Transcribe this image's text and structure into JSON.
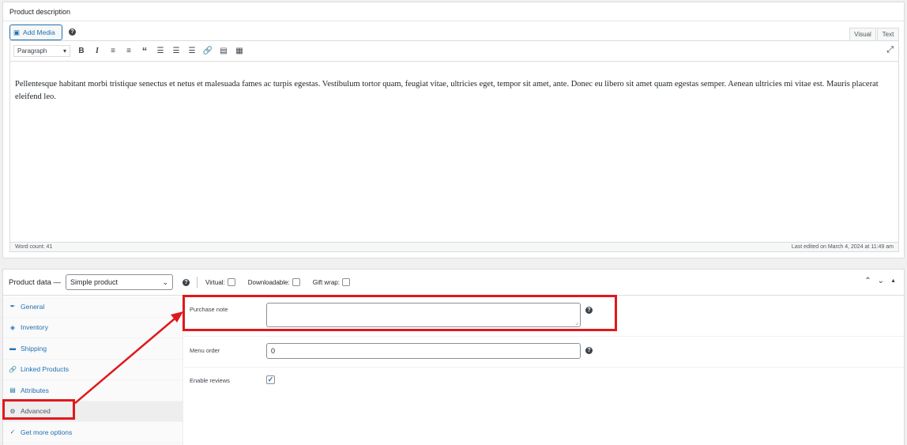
{
  "description": {
    "title": "Product description",
    "add_media": "Add Media",
    "tabs": [
      "Visual",
      "Text"
    ],
    "format": "Paragraph",
    "toolbar_icons": [
      "bold-icon",
      "italic-icon",
      "bullet-list-icon",
      "numbered-list-icon",
      "blockquote-icon",
      "align-left-icon",
      "align-center-icon",
      "align-right-icon",
      "link-icon",
      "read-more-icon",
      "toolbar-toggle-icon",
      "fullscreen-icon"
    ],
    "content": "Pellentesque habitant morbi tristique senectus et netus et malesuada fames ac turpis egestas. Vestibulum tortor quam, feugiat vitae, ultricies eget, tempor sit amet, ante. Donec eu libero sit amet quam egestas semper. Aenean ultricies mi vitae est. Mauris placerat eleifend leo.",
    "word_count": "Word count: 41",
    "last_edited": "Last edited on March 4, 2024 at 11:49 am"
  },
  "product_data": {
    "title": "Product data —",
    "type": "Simple product",
    "options": {
      "virtual": "Virtual:",
      "downloadable": "Downloadable:",
      "gift_wrap": "Gift wrap:"
    },
    "tabs": [
      {
        "label": "General",
        "icon": "wrench-icon"
      },
      {
        "label": "Inventory",
        "icon": "tag-icon"
      },
      {
        "label": "Shipping",
        "icon": "truck-icon"
      },
      {
        "label": "Linked Products",
        "icon": "link-icon"
      },
      {
        "label": "Attributes",
        "icon": "list-icon"
      },
      {
        "label": "Advanced",
        "icon": "gear-icon",
        "active": true
      },
      {
        "label": "Get more options",
        "icon": "plugin-icon"
      }
    ],
    "fields": {
      "purchase_note": {
        "label": "Purchase note",
        "value": ""
      },
      "menu_order": {
        "label": "Menu order",
        "value": "0"
      },
      "enable_reviews": {
        "label": "Enable reviews",
        "checked": true
      }
    }
  },
  "colors": {
    "highlight": "#e0181b",
    "link": "#2271b1"
  }
}
